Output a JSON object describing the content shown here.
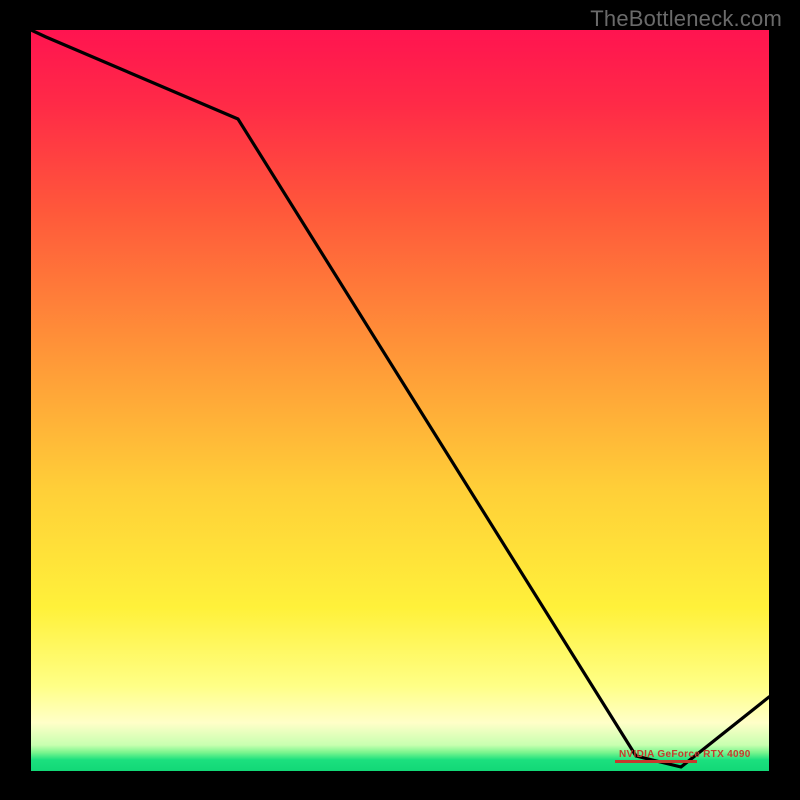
{
  "watermark": "TheBottleneck.com",
  "marker": {
    "label": "NVIDIA GeForce RTX 4090"
  },
  "colors": {
    "top": "#ff1744",
    "upper": "#ff4b3a",
    "mid": "#ffb93a",
    "lower": "#ffec3a",
    "pale": "#ffffb0",
    "green": "#18e07a",
    "curve": "#000000",
    "frame": "#000000"
  },
  "chart_data": {
    "type": "line",
    "title": "",
    "xlabel": "",
    "ylabel": "",
    "xlim": [
      0,
      100
    ],
    "ylim": [
      0,
      100
    ],
    "x": [
      0,
      2,
      28,
      82,
      88,
      100
    ],
    "values": [
      100,
      99,
      88,
      2,
      0.5,
      10
    ],
    "annotations": [
      {
        "text": "NVIDIA GeForce RTX 4090",
        "x": 85,
        "y": 1.5
      }
    ],
    "gradient_bands": [
      {
        "y0": 0,
        "y1": 2,
        "color": "#18e07a"
      },
      {
        "y0": 2,
        "y1": 10,
        "color": "#ffffb0"
      },
      {
        "y0": 10,
        "y1": 40,
        "color": "#ffec3a"
      },
      {
        "y0": 40,
        "y1": 70,
        "color": "#ffb93a"
      },
      {
        "y0": 70,
        "y1": 90,
        "color": "#ff4b3a"
      },
      {
        "y0": 90,
        "y1": 100,
        "color": "#ff1744"
      }
    ]
  }
}
